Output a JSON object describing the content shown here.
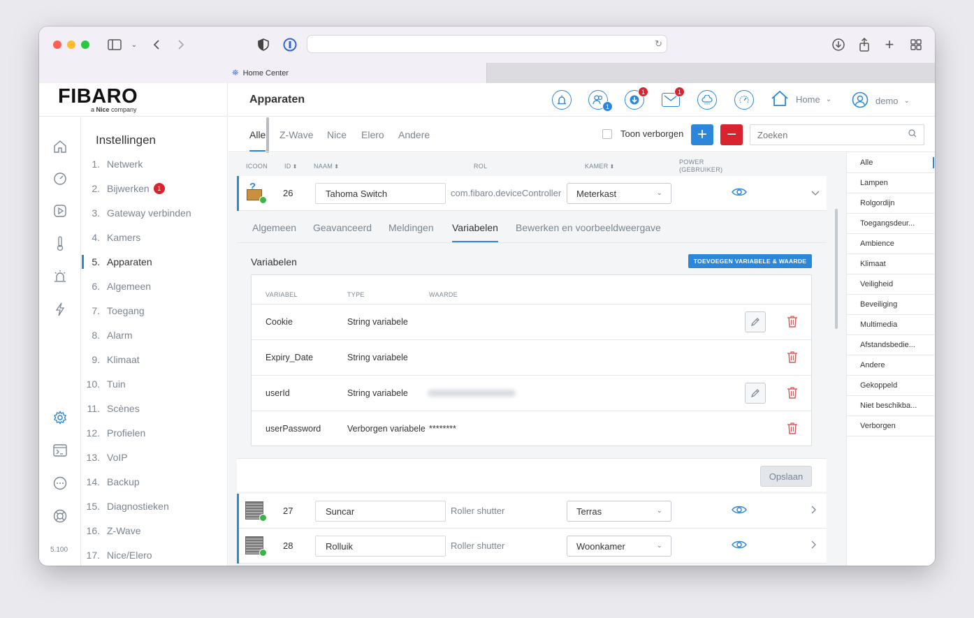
{
  "browser": {
    "tab_title": "Home Center"
  },
  "app": {
    "logo": "FIBARO",
    "logo_sub_prefix": "a ",
    "logo_sub_brand": "Nice",
    "logo_sub_suffix": " company",
    "page_title": "Apparaten",
    "version": "5.100"
  },
  "header": {
    "users_badge": "1",
    "updates_badge": "1",
    "messages_badge": "1",
    "home_label": "Home",
    "user_label": "demo"
  },
  "settings": {
    "title": "Instellingen",
    "items": [
      {
        "num": "1.",
        "label": "Netwerk"
      },
      {
        "num": "2.",
        "label": "Bijwerken",
        "badge": "1"
      },
      {
        "num": "3.",
        "label": "Gateway verbinden"
      },
      {
        "num": "4.",
        "label": "Kamers"
      },
      {
        "num": "5.",
        "label": "Apparaten"
      },
      {
        "num": "6.",
        "label": "Algemeen"
      },
      {
        "num": "7.",
        "label": "Toegang"
      },
      {
        "num": "8.",
        "label": "Alarm"
      },
      {
        "num": "9.",
        "label": "Klimaat"
      },
      {
        "num": "10.",
        "label": "Tuin"
      },
      {
        "num": "11.",
        "label": "Scènes"
      },
      {
        "num": "12.",
        "label": "Profielen"
      },
      {
        "num": "13.",
        "label": "VoIP"
      },
      {
        "num": "14.",
        "label": "Backup"
      },
      {
        "num": "15.",
        "label": "Diagnostieken"
      },
      {
        "num": "16.",
        "label": "Z-Wave"
      },
      {
        "num": "17.",
        "label": "Nice/Elero"
      }
    ]
  },
  "tabs": [
    "Alle",
    "Z-Wave",
    "Nice",
    "Elero",
    "Andere"
  ],
  "toolbar": {
    "show_hidden_label": "Toon verborgen",
    "add_symbol": "+",
    "remove_symbol": "−",
    "search_placeholder": "Zoeken"
  },
  "columns": {
    "icon": "ICOON",
    "id": "ID",
    "name": "NAAM",
    "role": "ROL",
    "room": "KAMER",
    "power": "POWER",
    "power_sub": "(GEBRUIKER)"
  },
  "devices": [
    {
      "id": "26",
      "name": "Tahoma Switch",
      "role": "com.fibaro.deviceController",
      "room": "Meterkast"
    },
    {
      "id": "27",
      "name": "Suncar",
      "role": "Roller shutter",
      "room": "Terras"
    },
    {
      "id": "28",
      "name": "Rolluik",
      "role": "Roller shutter",
      "room": "Woonkamer"
    }
  ],
  "detail": {
    "tabs": [
      "Algemeen",
      "Geavanceerd",
      "Meldingen",
      "Variabelen",
      "Bewerken en voorbeeldweergave"
    ],
    "section_title": "Variabelen",
    "add_button": "TOEVOEGEN VARIABELE & WAARDE",
    "headers": {
      "variable": "VARIABEL",
      "type": "TYPE",
      "value": "WAARDE"
    },
    "variables": [
      {
        "name": "Cookie",
        "type": "String variabele",
        "value": ""
      },
      {
        "name": "Expiry_Date",
        "type": "String variabele",
        "value": ""
      },
      {
        "name": "userId",
        "type": "String variabele",
        "value": ""
      },
      {
        "name": "userPassword",
        "type": "Verborgen variabele",
        "value": "********"
      }
    ],
    "save_label": "Opslaan"
  },
  "filters": [
    "Alle",
    "Lampen",
    "Rolgordijn",
    "Toegangsdeur...",
    "Ambience",
    "Klimaat",
    "Veiligheid",
    "Beveiliging",
    "Multimedia",
    "Afstandsbedie...",
    "Andere",
    "Gekoppeld",
    "Niet beschikba...",
    "Verborgen"
  ],
  "colors": {
    "accent": "#2c86d9",
    "danger": "#d9232f",
    "success": "#3cb34a"
  }
}
